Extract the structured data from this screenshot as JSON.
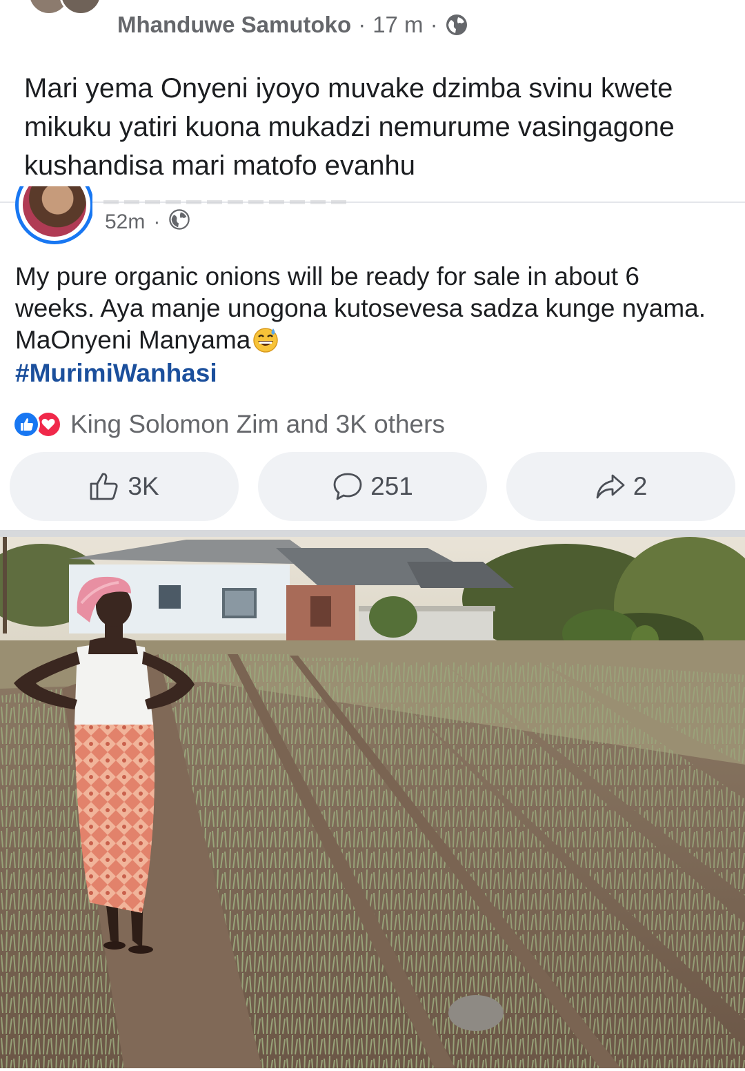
{
  "outer_post": {
    "author": "Mhanduwe Samutoko",
    "separator": "·",
    "time": "17 m",
    "text": "Mari yema Onyeni iyoyo muvake dzimba svinu kwete mikuku yatiri kuona mukadzi nemurume vasingagone kushandisa mari matofo evanhu"
  },
  "shared_post": {
    "time": "52m",
    "separator": "·",
    "text": "My pure organic onions will be ready for sale in about 6 weeks. Aya manje unogona kutosevesa sadza kunge nyama. MaOnyeni Manyama",
    "emoji_icon": "grinning-sweat-emoji",
    "hashtag": "#MurimiWanhasi",
    "reactions_summary": "King Solomon Zim and 3K others",
    "reaction_icons": [
      "like-icon",
      "love-icon"
    ],
    "actions": {
      "like_count": "3K",
      "comment_count": "251",
      "share_count": "2"
    }
  },
  "colors": {
    "accent_blue": "#1877f2",
    "love_red": "#f0284a",
    "hashtag": "#1b4f9c",
    "meta_gray": "#65676b",
    "pill_bg": "#f0f2f5"
  }
}
